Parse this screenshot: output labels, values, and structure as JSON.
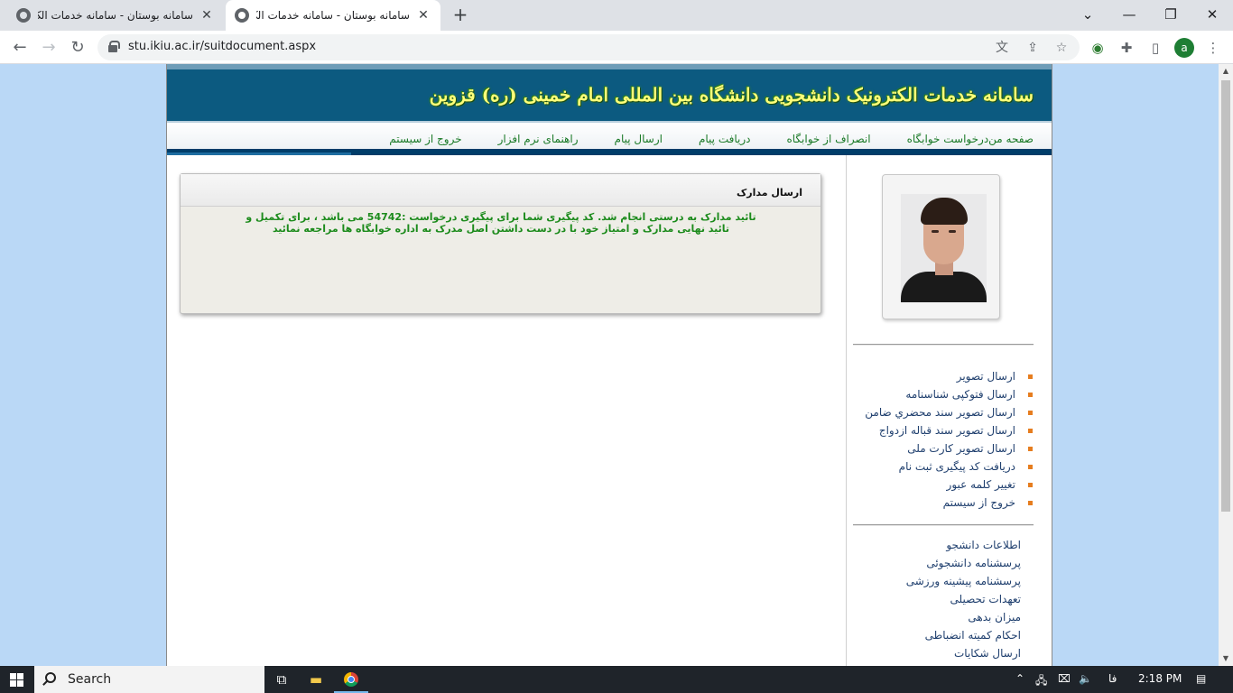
{
  "browser": {
    "tabs": [
      {
        "title": "سامانه بوستان - سامانه خدمات الک",
        "active": false
      },
      {
        "title": "سامانه بوستان - سامانه خدمات الک",
        "active": true
      }
    ],
    "new_tab": "+",
    "window_controls": {
      "minimize": "—",
      "maximize": "❐",
      "close": "✕",
      "tab_search": "⌄"
    },
    "nav": {
      "back": "←",
      "forward": "→",
      "reload": "↻"
    },
    "url": "stu.ikiu.ac.ir/suitdocument.aspx",
    "profile_initial": "a",
    "omnibox_icons": [
      "translate-icon",
      "share-icon",
      "star-icon"
    ],
    "toolbar_icons": [
      "extension-globe-icon",
      "puzzle-icon",
      "sidepanel-icon",
      "menu-icon"
    ]
  },
  "site": {
    "banner_title": "سامانه خدمات الکترونیک دانشجویی دانشگاه بین المللی امام خمینی (ره) قزوین",
    "topnav": [
      "صفحه من",
      "درخواست خوابگاه",
      "انصراف از خوابگاه",
      "دریافت پیام",
      "ارسال پیام",
      "راهنمای نرم افزار",
      "خروج از سیستم"
    ],
    "panel": {
      "title": "ارسال مدارک",
      "message": "تائید مدارک به درستی انجام شد. کد پیگیری شما برای پیگیری درخواست :54742 می باشد ، برای تکمیل و تائید نهایی مدارک و امتیاز خود با در دست داشتن اصل مدرک به اداره خوابگاه ها مراجعه نمائید"
    },
    "sidebar_links": [
      "ارسال تصویر",
      "ارسال فتوکپی شناسنامه",
      "ارسال تصویر سند محضري ضامن",
      "ارسال تصویر سند قباله ازدواج",
      "ارسال تصویر کارت ملی",
      "دریافت کد پیگیری ثبت نام",
      "تغییر کلمه عبور",
      "خروج از سیستم"
    ],
    "info_links": [
      "اطلاعات دانشجو",
      "پرسشنامه دانشجوئی",
      "پرسشنامه پیشینه ورزشی",
      "تعهدات تحصیلی",
      "میزان بدهی",
      "احکام کمیته انضباطی",
      "ارسال شکایات"
    ]
  },
  "taskbar": {
    "search_label": "Search",
    "language": "فا",
    "time": "2:18 PM"
  },
  "colors": {
    "page_bg": "#bad8f6",
    "banner_bg": "#0c5a80",
    "banner_text": "#ffff7a",
    "nav_text": "#1b7a28",
    "message_text": "#1c8b1c",
    "bullet": "#e67d1f"
  }
}
